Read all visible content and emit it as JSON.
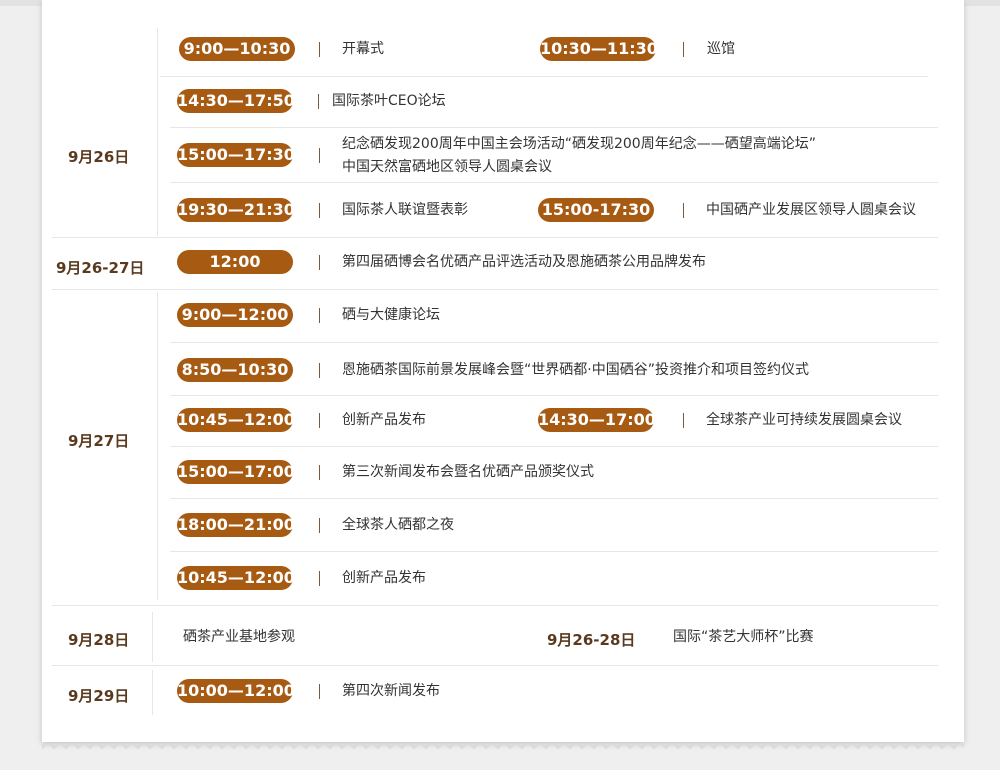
{
  "dates": {
    "d0926": "9月26日",
    "d0926_27": "9月26-27日",
    "d0927": "9月27日",
    "d0928": "9月28日",
    "d0926_28": "9月26-28日",
    "d0929": "9月29日"
  },
  "sep26": {
    "r1": {
      "t1": "9:00—10:30",
      "e1": "开幕式",
      "t2": "10:30—11:30",
      "e2": "巡馆"
    },
    "r2": {
      "t1": "14:30—17:50",
      "e1": "国际茶叶CEO论坛"
    },
    "r3": {
      "t1": "15:00—17:30",
      "e1_line1": "纪念硒发现200周年中国主会场活动“硒发现200周年纪念——硒望高端论坛”",
      "e1_line2": "中国天然富硒地区领导人圆桌会议"
    },
    "r4": {
      "t1": "19:30—21:30",
      "e1": "国际茶人联谊暨表彰",
      "t2": "15:00-17:30",
      "e2": "中国硒产业发展区领导人圆桌会议"
    }
  },
  "sep26_27": {
    "t1": "12:00",
    "e1": "第四届硒博会名优硒产品评选活动及恩施硒茶公用品牌发布"
  },
  "sep27": {
    "r1": {
      "t1": "9:00—12:00",
      "e1": "硒与大健康论坛"
    },
    "r2": {
      "t1": "8:50—10:30",
      "e1": "恩施硒茶国际前景发展峰会暨“世界硒都·中国硒谷”投资推介和项目签约仪式"
    },
    "r3": {
      "t1": "10:45—12:00",
      "e1": "创新产品发布",
      "t2": "14:30—17:00",
      "e2": "全球茶产业可持续发展圆桌会议"
    },
    "r4": {
      "t1": "15:00—17:00",
      "e1": "第三次新闻发布会暨名优硒产品颁奖仪式"
    },
    "r5": {
      "t1": "18:00—21:00",
      "e1": "全球茶人硒都之夜"
    },
    "r6": {
      "t1": "10:45—12:00",
      "e1": "创新产品发布"
    }
  },
  "sep28": {
    "e1": "硒茶产业基地参观",
    "e2": "国际“茶艺大师杯”比赛"
  },
  "sep29": {
    "t1": "10:00—12:00",
    "e1": "第四次新闻发布"
  },
  "colors": {
    "pill": "#a65a12",
    "date_text": "#5a3a1e",
    "separator": "#7a5a3a",
    "line": "#e6e6e6"
  }
}
